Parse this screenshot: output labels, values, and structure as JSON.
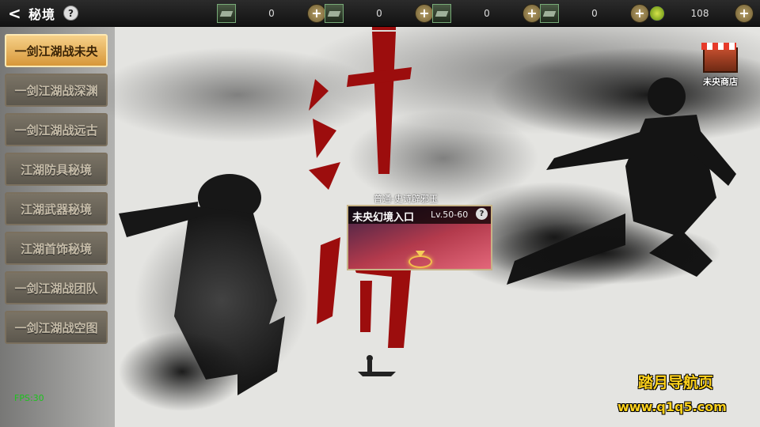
{
  "header": {
    "title": "秘境",
    "back_icon": "back-arrow-icon",
    "help_glyph": "?"
  },
  "resources": [
    {
      "icon": "scroll-item-icon",
      "value": "0"
    },
    {
      "icon": "scroll-item-icon",
      "value": "0"
    },
    {
      "icon": "scroll-item-icon",
      "value": "0"
    },
    {
      "icon": "scroll-item-icon",
      "value": "0"
    },
    {
      "icon": "jade-coin-icon",
      "value": "108"
    }
  ],
  "plus_glyph": "+",
  "sidebar": {
    "items": [
      {
        "label": "一剑江湖战未央",
        "active": true
      },
      {
        "label": "一剑江湖战深渊",
        "active": false
      },
      {
        "label": "一剑江湖战远古",
        "active": false
      },
      {
        "label": "江湖防具秘境",
        "active": false
      },
      {
        "label": "江湖武器秘境",
        "active": false
      },
      {
        "label": "江湖首饰秘境",
        "active": false
      },
      {
        "label": "一剑江湖战团队",
        "active": false
      },
      {
        "label": "一剑江湖战空图",
        "active": false
      }
    ]
  },
  "shop": {
    "label": "未央商店",
    "icon": "shop-stall-icon"
  },
  "dungeon": {
    "tag": "普通-史诗辟邪玉",
    "name": "未央幻境入口",
    "level": "Lv.50-60",
    "help_glyph": "?"
  },
  "debug": {
    "fps": "FPS:30"
  },
  "watermark": {
    "line1": "踏月导航页",
    "line2": "www.q1q5.com"
  },
  "colors": {
    "active_tab": "#e0a445",
    "calligraphy_red": "#9c0d0d",
    "watermark": "#ffd21c",
    "fps": "#1cc41c"
  }
}
